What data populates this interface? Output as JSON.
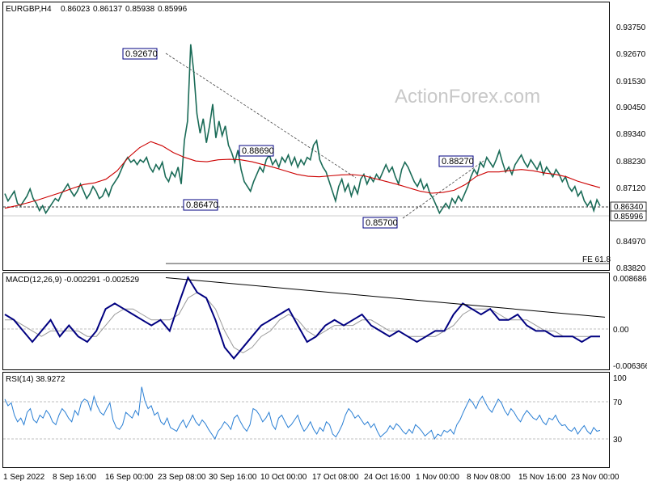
{
  "chart_data": {
    "type": "line",
    "instrument": "EURGBP",
    "timeframe": "H4",
    "header": {
      "symbol": "EURGBP,H4",
      "open": "0.86023",
      "high": "0.86137",
      "low": "0.85938",
      "close": "0.85996"
    },
    "watermark": "ActionForex.com",
    "x_tick_labels": [
      "1 Sep 2022",
      "8 Sep 16:00",
      "16 Sep 00:00",
      "23 Sep 08:00",
      "30 Sep 16:00",
      "10 Oct 00:00",
      "17 Oct 08:00",
      "24 Oct 16:00",
      "1 Nov 00:00",
      "8 Nov 08:00",
      "15 Nov 16:00",
      "23 Nov 00:00"
    ],
    "price_panel": {
      "ylim": [
        0.8335,
        0.944
      ],
      "y_ticks": [
        "0.93750",
        "0.92670",
        "0.91530",
        "0.90450",
        "0.89340",
        "0.88230",
        "0.87120",
        "0.86340",
        "0.85996",
        "0.84970",
        "0.83820"
      ],
      "last_price": "0.85996",
      "marked_level": "0.86340",
      "fib_label": "FE 61.8",
      "fib_level": 0.8381,
      "annotations": [
        {
          "label": "0.92670",
          "value": 0.9267
        },
        {
          "label": "0.88690",
          "value": 0.8869
        },
        {
          "label": "0.86470",
          "value": 0.8647
        },
        {
          "label": "0.85700",
          "value": 0.857
        },
        {
          "label": "0.88270",
          "value": 0.8827
        }
      ],
      "price_series": [
        0.865,
        0.862,
        0.864,
        0.866,
        0.861,
        0.86,
        0.862,
        0.864,
        0.867,
        0.863,
        0.861,
        0.858,
        0.86,
        0.857,
        0.859,
        0.861,
        0.863,
        0.862,
        0.865,
        0.867,
        0.869,
        0.866,
        0.864,
        0.866,
        0.869,
        0.866,
        0.863,
        0.865,
        0.868,
        0.866,
        0.863,
        0.864,
        0.867,
        0.864,
        0.868,
        0.87,
        0.872,
        0.875,
        0.878,
        0.88,
        0.878,
        0.879,
        0.877,
        0.879,
        0.878,
        0.88,
        0.876,
        0.874,
        0.877,
        0.875,
        0.878,
        0.872,
        0.87,
        0.874,
        0.872,
        0.876,
        0.869,
        0.887,
        0.895,
        0.9267,
        0.915,
        0.898,
        0.89,
        0.896,
        0.886,
        0.893,
        0.902,
        0.888,
        0.895,
        0.889,
        0.893,
        0.885,
        0.882,
        0.878,
        0.883,
        0.875,
        0.87,
        0.868,
        0.866,
        0.87,
        0.873,
        0.876,
        0.874,
        0.879,
        0.881,
        0.877,
        0.879,
        0.876,
        0.88,
        0.878,
        0.881,
        0.877,
        0.88,
        0.876,
        0.879,
        0.877,
        0.88,
        0.879,
        0.885,
        0.8869,
        0.879,
        0.876,
        0.874,
        0.87,
        0.866,
        0.862,
        0.868,
        0.871,
        0.866,
        0.869,
        0.864,
        0.868,
        0.865,
        0.871,
        0.873,
        0.869,
        0.872,
        0.87,
        0.873,
        0.871,
        0.874,
        0.877,
        0.874,
        0.876,
        0.872,
        0.869,
        0.875,
        0.878,
        0.876,
        0.873,
        0.87,
        0.868,
        0.871,
        0.867,
        0.869,
        0.865,
        0.863,
        0.86,
        0.857,
        0.859,
        0.861,
        0.859,
        0.863,
        0.861,
        0.864,
        0.862,
        0.865,
        0.868,
        0.872,
        0.875,
        0.873,
        0.878,
        0.876,
        0.88,
        0.878,
        0.876,
        0.879,
        0.8827,
        0.878,
        0.874,
        0.876,
        0.873,
        0.877,
        0.879,
        0.881,
        0.878,
        0.876,
        0.879,
        0.877,
        0.875,
        0.878,
        0.873,
        0.876,
        0.874,
        0.872,
        0.875,
        0.873,
        0.87,
        0.872,
        0.868,
        0.866,
        0.868,
        0.864,
        0.866,
        0.862,
        0.86,
        0.862,
        0.858,
        0.8625,
        0.86
      ],
      "ma_series": [
        0.859,
        0.86,
        0.8612,
        0.8625,
        0.864,
        0.8655,
        0.8672,
        0.8688,
        0.8695,
        0.871,
        0.8745,
        0.88,
        0.884,
        0.8865,
        0.8848,
        0.882,
        0.88,
        0.8785,
        0.8782,
        0.879,
        0.8792,
        0.879,
        0.8782,
        0.877,
        0.8758,
        0.8744,
        0.873,
        0.8722,
        0.872,
        0.8724,
        0.8728,
        0.8729,
        0.8724,
        0.8712,
        0.87,
        0.8688,
        0.8674,
        0.866,
        0.8652,
        0.8655,
        0.8664,
        0.8688,
        0.8722,
        0.874,
        0.874,
        0.8746,
        0.875,
        0.8745,
        0.8736,
        0.873,
        0.872,
        0.8702,
        0.8688,
        0.8675
      ]
    },
    "macd_panel": {
      "title": "MACD(12,26,9) -0.002291 -0.002529",
      "ylim": [
        -0.008,
        0.0095
      ],
      "y_ticks": [
        "0.008686",
        "0.00",
        "-0.006366"
      ],
      "macd_series": [
        0.002,
        0.001,
        -0.001,
        -0.003,
        -0.001,
        0.001,
        -0.002,
        0.0,
        -0.002,
        -0.003,
        -0.001,
        0.003,
        0.004,
        0.003,
        0.002,
        0.001,
        0.0,
        0.001,
        -0.001,
        0.004,
        0.0087,
        0.006,
        0.005,
        0.001,
        -0.004,
        -0.006,
        -0.004,
        -0.002,
        0.0,
        0.001,
        0.002,
        0.003,
        0.0,
        -0.003,
        -0.002,
        0.0,
        0.001,
        0.0,
        0.001,
        0.002,
        0.0,
        -0.001,
        -0.002,
        -0.001,
        -0.002,
        -0.003,
        -0.002,
        -0.001,
        -0.001,
        0.002,
        0.004,
        0.003,
        0.002,
        0.003,
        0.001,
        0.001,
        0.002,
        0.0,
        -0.001,
        -0.001,
        -0.002,
        -0.002,
        -0.002,
        -0.003,
        -0.002,
        -0.002
      ],
      "signal_series": [
        0.001,
        0.001,
        0.0,
        -0.001,
        -0.002,
        -0.001,
        -0.001,
        -0.001,
        -0.001,
        -0.002,
        -0.002,
        0.0,
        0.002,
        0.003,
        0.003,
        0.002,
        0.001,
        0.001,
        0.001,
        0.002,
        0.005,
        0.006,
        0.005,
        0.003,
        -0.001,
        -0.004,
        -0.005,
        -0.004,
        -0.002,
        -0.001,
        0.001,
        0.002,
        0.001,
        -0.001,
        -0.002,
        -0.001,
        0.0,
        0.0,
        0.0,
        0.001,
        0.001,
        0.0,
        -0.001,
        -0.001,
        -0.002,
        -0.002,
        -0.002,
        -0.002,
        -0.001,
        0.0,
        0.002,
        0.003,
        0.003,
        0.003,
        0.002,
        0.001,
        0.001,
        0.001,
        0.0,
        -0.001,
        -0.001,
        -0.002,
        -0.002,
        -0.002,
        -0.002,
        -0.002
      ],
      "trendline": [
        0.0087,
        0.0015
      ]
    },
    "rsi_panel": {
      "title": "RSI(14) 38.9272",
      "ylim": [
        0,
        100
      ],
      "y_ticks": [
        "100",
        "70",
        "30"
      ],
      "levels": [
        70,
        30
      ],
      "rsi_series": [
        72,
        65,
        68,
        55,
        48,
        52,
        45,
        58,
        62,
        50,
        47,
        55,
        52,
        60,
        56,
        48,
        45,
        55,
        62,
        58,
        52,
        48,
        60,
        55,
        68,
        72,
        70,
        60,
        75,
        65,
        58,
        55,
        62,
        68,
        50,
        42,
        40,
        45,
        58,
        55,
        52,
        60,
        55,
        85,
        70,
        62,
        65,
        55,
        58,
        48,
        45,
        52,
        42,
        40,
        38,
        45,
        50,
        42,
        48,
        55,
        48,
        44,
        50,
        46,
        40,
        35,
        30,
        38,
        42,
        48,
        45,
        40,
        52,
        55,
        48,
        42,
        38,
        45,
        62,
        60,
        55,
        48,
        52,
        58,
        45,
        40,
        52,
        55,
        48,
        42,
        45,
        50,
        55,
        45,
        38,
        42,
        48,
        40,
        35,
        42,
        38,
        48,
        45,
        35,
        32,
        38,
        45,
        55,
        62,
        58,
        52,
        55,
        50,
        45,
        48,
        42,
        46,
        38,
        32,
        35,
        38,
        44,
        40,
        46,
        43,
        38,
        35,
        40,
        36,
        45,
        42,
        38,
        33,
        36,
        39,
        30,
        35,
        33,
        39,
        37,
        40,
        35,
        45,
        50,
        58,
        65,
        72,
        68,
        62,
        70,
        75,
        68,
        62,
        58,
        65,
        72,
        68,
        60,
        55,
        62,
        58,
        52,
        48,
        55,
        60,
        56,
        52,
        50,
        55,
        48,
        45,
        52,
        50,
        55,
        48,
        44,
        45,
        40,
        38,
        42,
        35,
        40,
        44,
        38,
        35,
        42,
        38,
        39
      ]
    }
  }
}
